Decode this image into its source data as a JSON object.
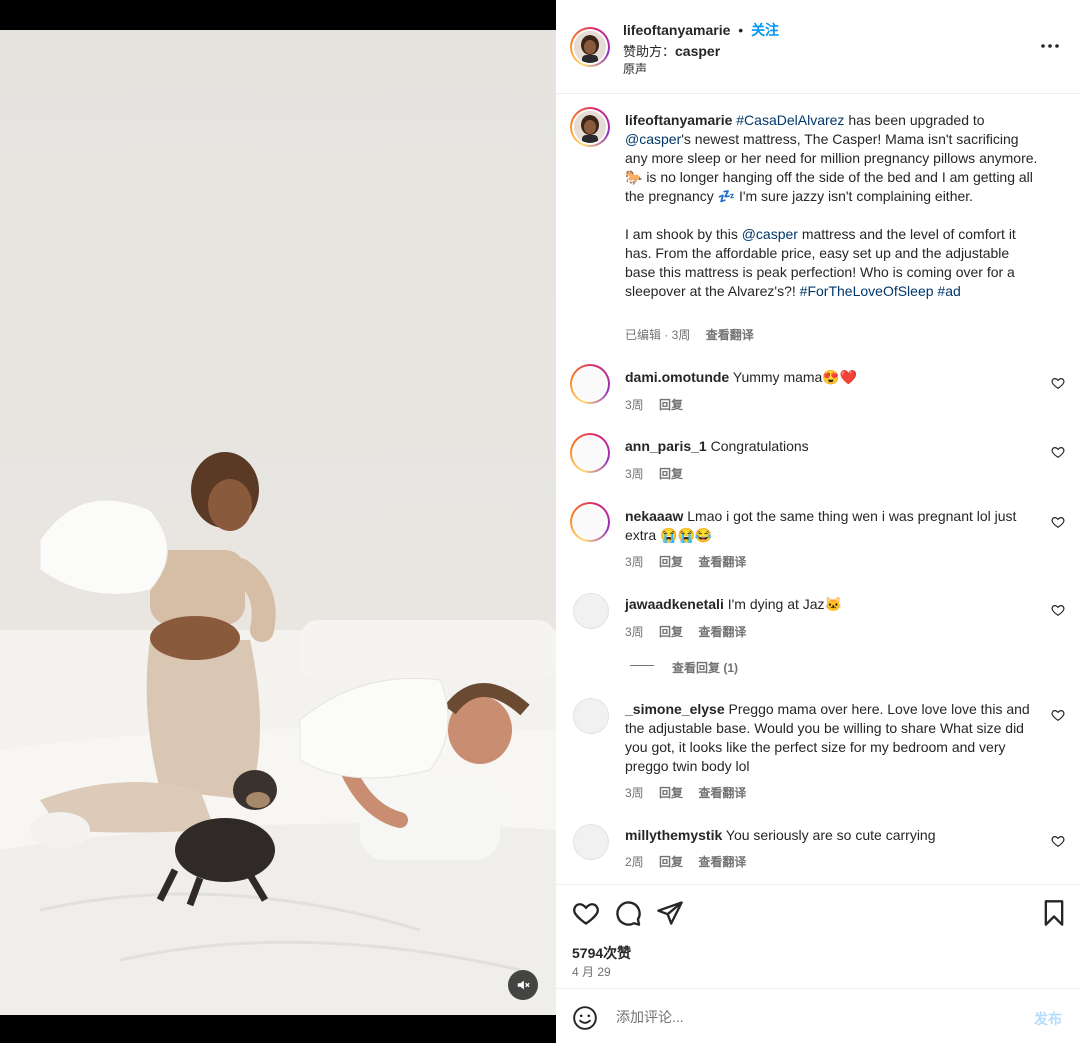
{
  "post": {
    "username": "lifeoftanyamarie",
    "follow_label": "关注",
    "sponsor_prefix": "赞助方：",
    "sponsor_name": "casper",
    "audio_label": "原声",
    "more_icon": "more-horizontal-icon"
  },
  "caption": {
    "username": "lifeoftanyamarie",
    "p1_hashtag": "#CasaDelAlvarez",
    "p1_a": " has been upgraded to ",
    "p1_mention": "@casper",
    "p1_b": "'s newest mattress, The Casper! Mama isn't sacrificing any more sleep or her need for million pregnancy pillows anymore. 🐎 is no longer hanging off the side of the bed and I am getting all the pregnancy 💤 I'm sure jazzy isn't complaining either.",
    "p2_a": "I am shook by this ",
    "p2_mention": "@casper",
    "p2_b": " mattress and the level of comfort it has. From the affordable price, easy set up and the adjustable base this mattress is peak perfection! Who is coming over for a sleepover at the Alvarez's?! ",
    "p2_tag1": "#ForTheLoveOfSleep",
    "p2_tag2": " #ad",
    "edited_time": "已编辑 · 3周",
    "translate": "查看翻译"
  },
  "comments": [
    {
      "username": "dami.omotunde",
      "text": "Yummy mama😍❤️",
      "time": "3周",
      "reply": "回复",
      "translate": ""
    },
    {
      "username": "ann_paris_1",
      "text": "Congratulations",
      "time": "3周",
      "reply": "回复",
      "translate": ""
    },
    {
      "username": "nekaaaw",
      "text": "Lmao i got the same thing wen i was pregnant lol just extra 😭😭😂",
      "time": "3周",
      "reply": "回复",
      "translate": "查看翻译"
    },
    {
      "username": "jawaadkenetali",
      "text": "I'm dying at Jaz🐱",
      "time": "3周",
      "reply": "回复",
      "translate": "查看翻译"
    },
    {
      "username": "_simone_elyse",
      "text": "Preggo mama over here. Love love love this and the adjustable base. Would you be willing to share What size did you got, it looks like the perfect size for my bedroom and very preggo twin body lol",
      "time": "3周",
      "reply": "回复",
      "translate": "查看翻译"
    },
    {
      "username": "millythemystik",
      "text": "You seriously are so cute carrying",
      "time": "2周",
      "reply": "回复",
      "translate": "查看翻译"
    }
  ],
  "view_replies": "查看回复 (1)",
  "stats": {
    "likes": "5794次赞",
    "date": "4 月 29"
  },
  "composer": {
    "placeholder": "添加评论...",
    "post_label": "发布"
  },
  "colors": {
    "link": "#00376b",
    "follow": "#0095f6",
    "post_disabled": "#b3dbff"
  }
}
